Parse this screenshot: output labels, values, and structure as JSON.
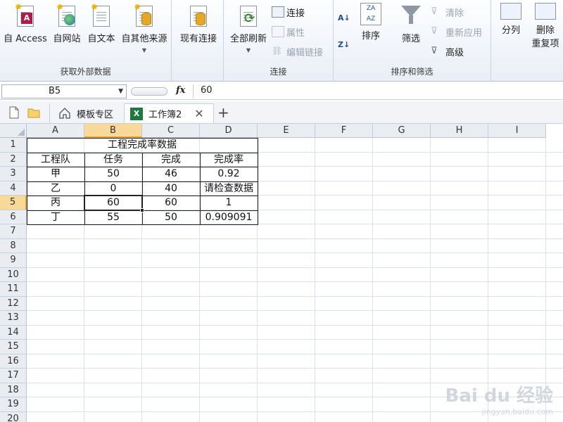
{
  "ribbon": {
    "get_external": {
      "label": "获取外部数据",
      "buttons": [
        {
          "label": "自 Access"
        },
        {
          "label": "自网站"
        },
        {
          "label": "自文本"
        },
        {
          "label": "自其他来源"
        }
      ]
    },
    "existing": {
      "label": "现有连接"
    },
    "connections": {
      "label": "连接",
      "refresh_all": "全部刷新",
      "connect": "连接",
      "properties": "属性",
      "edit_links": "编辑链接"
    },
    "sort_filter": {
      "label": "排序和筛选",
      "sort": "排序",
      "filter": "筛选",
      "clear": "清除",
      "reapply": "重新应用",
      "advanced": "高级"
    },
    "data_tools": {
      "split": "分列",
      "remove_line1": "删除",
      "remove_line2": "重复项"
    }
  },
  "formula_bar": {
    "name_box": "B5",
    "fx": "fx",
    "value": "60"
  },
  "tabs": [
    {
      "label": "模板专区"
    },
    {
      "label": "工作簿2",
      "icon_text": "X"
    }
  ],
  "columns": [
    "A",
    "B",
    "C",
    "D",
    "E",
    "F",
    "G",
    "H",
    "I"
  ],
  "rows": [
    "1",
    "2",
    "3",
    "4",
    "5",
    "6",
    "7",
    "8",
    "9",
    "10",
    "11",
    "12",
    "13",
    "14",
    "15",
    "16",
    "17",
    "18",
    "19",
    "20"
  ],
  "sheet": {
    "title": "工程完成率数据",
    "headers": [
      "工程队",
      "任务",
      "完成",
      "完成率"
    ],
    "data": [
      [
        "甲",
        "50",
        "46",
        "0.92"
      ],
      [
        "乙",
        "0",
        "40",
        "请检查数据"
      ],
      [
        "丙",
        "60",
        "60",
        "1"
      ],
      [
        "丁",
        "55",
        "50",
        "0.909091"
      ]
    ]
  },
  "selection": {
    "column": "B",
    "row": "5"
  },
  "watermark": {
    "brand": "Bai du 经验",
    "url": "jingyan.baidu.com"
  }
}
